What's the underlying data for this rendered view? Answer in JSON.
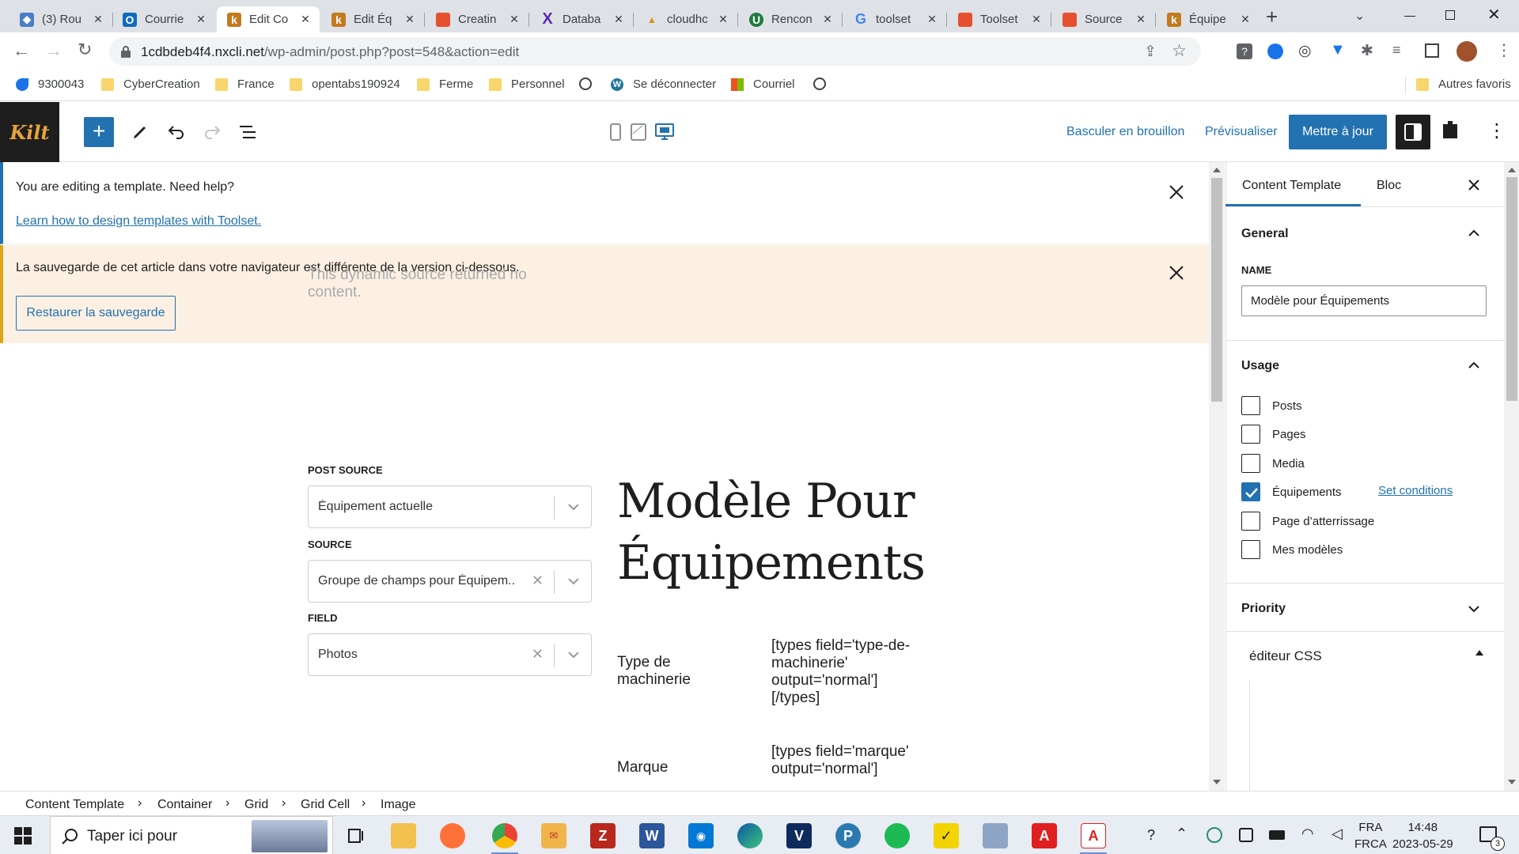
{
  "browser": {
    "tabs": [
      {
        "title": "(3) Rou",
        "favicon_color": "#4a7dc9"
      },
      {
        "title": "Courrie",
        "favicon_color": "#0f6cbd"
      },
      {
        "title": "Edit Co",
        "favicon_color": "#c47a1e",
        "active": true
      },
      {
        "title": "Edit Éq",
        "favicon_color": "#c47a1e"
      },
      {
        "title": "Creatin",
        "favicon_color": "#e5502f"
      },
      {
        "title": "Databa",
        "favicon_color": "#5b2ab5"
      },
      {
        "title": "cloudhc",
        "favicon_color": "#e08a1e"
      },
      {
        "title": "Rencon",
        "favicon_color": "#1e7a3c"
      },
      {
        "title": "toolset",
        "favicon_color": "#4285f4"
      },
      {
        "title": "Toolset",
        "favicon_color": "#e5502f"
      },
      {
        "title": "Source",
        "favicon_color": "#e5502f"
      },
      {
        "title": "Équipe",
        "favicon_color": "#c47a1e"
      }
    ],
    "url_host": "1cdbdeb4f4.nxcli.net",
    "url_path": "/wp-admin/post.php?post=548&action=edit",
    "bookmarks": [
      {
        "label": "9300043",
        "icon": "bird-icon"
      },
      {
        "label": "CyberCreation",
        "icon": "folder-icon"
      },
      {
        "label": "France",
        "icon": "folder-icon"
      },
      {
        "label": "opentabs190924",
        "icon": "folder-icon"
      },
      {
        "label": "Ferme",
        "icon": "folder-icon"
      },
      {
        "label": "Personnel",
        "icon": "folder-icon"
      },
      {
        "label": "",
        "icon": "globe-icon"
      },
      {
        "label": "Se déconnecter",
        "icon": "wordpress-icon"
      },
      {
        "label": "Courriel",
        "icon": "microsoft-icon"
      },
      {
        "label": "",
        "icon": "globe-icon"
      }
    ],
    "other_bookmarks": "Autres favoris"
  },
  "editor": {
    "logo_text": "Kilt",
    "header_links": {
      "draft": "Basculer en brouillon",
      "preview": "Prévisualiser"
    },
    "update_label": "Mettre à jour",
    "notices": {
      "template": "You are editing a template. Need help?",
      "template_link": "Learn how to design templates with Toolset.",
      "backup": "La sauvegarde de cet article dans votre navigateur est différente de la version ci-dessous.",
      "restore_label": "Restaurer la sauvegarde"
    },
    "content": {
      "dynamic_message": "This dynamic source returned no content.",
      "post_source_label": "POST SOURCE",
      "post_source_value": "Équipement actuelle",
      "source_label": "SOURCE",
      "source_value": "Groupe de champs pour Équipem...",
      "field_label": "FIELD",
      "field_value": "Photos",
      "title_line1": "Modèle Pour",
      "title_line2": "Équipements",
      "fields": [
        {
          "name": "Type de machinerie",
          "code": "[types field='type-de-machinerie' output='normal'][/types]"
        },
        {
          "name": "Marque",
          "code": "[types field='marque' output='normal']"
        }
      ]
    },
    "breadcrumbs": [
      "Content Template",
      "Container",
      "Grid",
      "Grid Cell",
      "Image"
    ]
  },
  "sidebar": {
    "tab_template": "Content Template",
    "tab_block": "Bloc",
    "general_title": "General",
    "name_label": "NAME",
    "name_value": "Modèle pour Équipements",
    "usage_title": "Usage",
    "usage_items": [
      {
        "label": "Posts",
        "checked": false
      },
      {
        "label": "Pages",
        "checked": false
      },
      {
        "label": "Media",
        "checked": false
      },
      {
        "label": "Équipements",
        "checked": true
      },
      {
        "label": "Page d’atterrissage",
        "checked": false
      },
      {
        "label": "Mes modèles",
        "checked": false
      }
    ],
    "set_conditions": "Set conditions",
    "priority_title": "Priority",
    "css_title": "éditeur CSS"
  },
  "taskbar": {
    "search_placeholder": "Taper ici pour",
    "lang_line1": "FRA",
    "lang_line2": "FRCA",
    "time": "14:48",
    "date": "2023-05-29",
    "notification_count": "3"
  },
  "colors": {
    "accent": "#2271b1",
    "notice_warning_bg": "#fcf0e3",
    "notice_warning_border": "#dba617"
  }
}
